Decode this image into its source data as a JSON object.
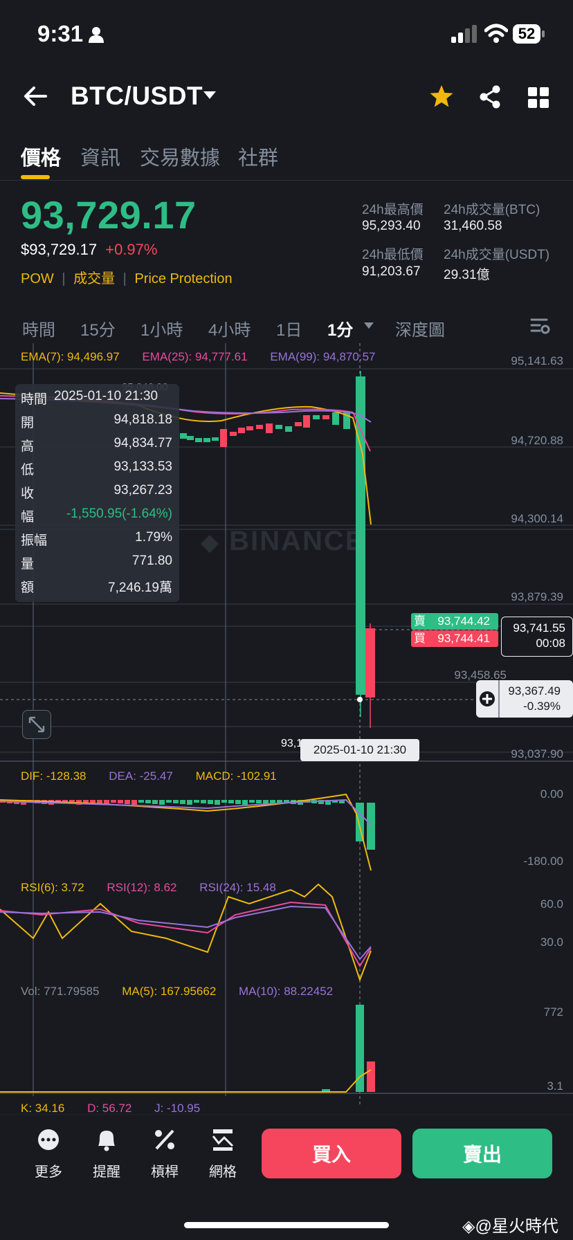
{
  "status_bar": {
    "time": "9:31",
    "battery": "52"
  },
  "header": {
    "pair": "BTC/USDT"
  },
  "tabs": [
    "價格",
    "資訊",
    "交易數據",
    "社群"
  ],
  "price": {
    "last": "93,729.17",
    "usd": "$93,729.17",
    "change": "+0.97%",
    "tags": [
      "POW",
      "成交量",
      "Price Protection"
    ]
  },
  "stats": {
    "high_label": "24h最高價",
    "high": "95,293.40",
    "vol_btc_label": "24h成交量(BTC)",
    "vol_btc": "31,460.58",
    "low_label": "24h最低價",
    "low": "91,203.67",
    "vol_usdt_label": "24h成交量(USDT)",
    "vol_usdt": "29.31億"
  },
  "intervals": [
    "時間",
    "15分",
    "1小時",
    "4小時",
    "1日",
    "1分",
    "深度圖"
  ],
  "indicators": {
    "ema": [
      "EMA(7): 94,496.97",
      "EMA(25): 94,777.61",
      "EMA(99): 94,870.57"
    ],
    "macd": [
      "DIF: -128.38",
      "DEA: -25.47",
      "MACD: -102.91"
    ],
    "rsi": [
      "RSI(6): 3.72",
      "RSI(12): 8.62",
      "RSI(24): 15.48"
    ],
    "vol": [
      "Vol: 771.79585",
      "MA(5): 167.95662",
      "MA(10): 88.22452"
    ],
    "kdj": [
      "K: 34.16",
      "D: 56.72",
      "J: -10.95"
    ]
  },
  "axis": {
    "main": [
      "95,141.63",
      "94,720.88",
      "94,300.14",
      "93,879.39",
      "93,458.65",
      "93,037.90"
    ],
    "macd": [
      "0.00",
      "-180.00"
    ],
    "rsi": [
      "60.0",
      "30.0"
    ],
    "vol": [
      "772",
      "3.1"
    ]
  },
  "chart_labels": {
    "high_mark": "95,046.00",
    "low_mark": "93,1",
    "crosshair_time": "2025-01-10 21:30"
  },
  "ohlc": [
    {
      "k": "時間",
      "v": "2025-01-10 21:30"
    },
    {
      "k": "開",
      "v": "94,818.18"
    },
    {
      "k": "高",
      "v": "94,834.77"
    },
    {
      "k": "低",
      "v": "93,133.53"
    },
    {
      "k": "收",
      "v": "93,267.23"
    },
    {
      "k": "幅",
      "v": "-1,550.95(-1.64%)"
    },
    {
      "k": "振幅",
      "v": "1.79%"
    },
    {
      "k": "量",
      "v": "771.80"
    },
    {
      "k": "額",
      "v": "7,246.19萬"
    }
  ],
  "order_tags": {
    "sell_label": "賣",
    "sell_price": "93,744.42",
    "buy_label": "買",
    "buy_price": "93,744.41",
    "last_price": "93,741.55",
    "countdown": "00:08",
    "cross_price": "93,367.49",
    "cross_pct": "-0.39%"
  },
  "watermark": "BINANCE",
  "bottom_bar": {
    "items": [
      "更多",
      "提醒",
      "槓桿",
      "網格"
    ],
    "buy": "買入",
    "sell": "賣出"
  },
  "source_mark": "@星火時代",
  "colors": {
    "green": "#2ebd85",
    "red": "#f6465d",
    "yellow": "#f0b90b",
    "bg": "#181a20"
  }
}
